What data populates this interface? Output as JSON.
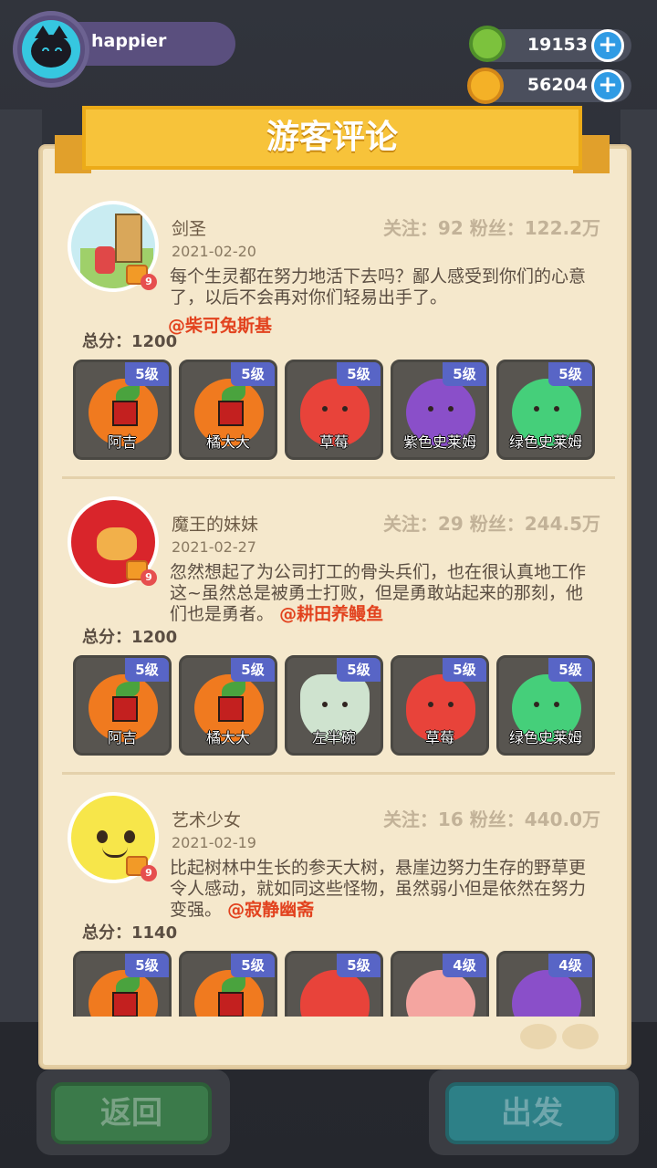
{
  "header": {
    "username": "happier",
    "currency_1": {
      "icon": "green-coin-icon",
      "value": "19153"
    },
    "currency_2": {
      "icon": "gold-planet-icon",
      "value": "56204"
    },
    "add_symbol": "+"
  },
  "title": "游客评论",
  "reviews": [
    {
      "name": "剑圣",
      "date": "2021-02-20",
      "stats": "关注：92 粉丝：122.2万",
      "level": "9",
      "text": "每个生灵都在努力地活下去吗？鄙人感受到你们的心意了，以后不会再对你们轻易出手了。",
      "mention": "@柴可兔斯基",
      "score": "总分：1200",
      "monsters": [
        {
          "name": "阿吉",
          "level": "5级",
          "kind": "orange"
        },
        {
          "name": "橘大大",
          "level": "5级",
          "kind": "orange"
        },
        {
          "name": "草莓",
          "level": "5级",
          "kind": "strawberry"
        },
        {
          "name": "紫色史莱姆",
          "level": "5级",
          "kind": "purple-slime"
        },
        {
          "name": "绿色史莱姆",
          "level": "5级",
          "kind": "green-slime"
        }
      ]
    },
    {
      "name": "魔王的妹妹",
      "date": "2021-02-27",
      "stats": "关注：29 粉丝：244.5万",
      "level": "9",
      "text": "忽然想起了为公司打工的骨头兵们，也在很认真地工作这~虽然总是被勇士打败，但是勇敢站起来的那刻，他们也是勇者。",
      "mention": "@耕田养鳗鱼",
      "score": "总分：1200",
      "monsters": [
        {
          "name": "阿吉",
          "level": "5级",
          "kind": "orange"
        },
        {
          "name": "橘大大",
          "level": "5级",
          "kind": "orange"
        },
        {
          "name": "左半碗",
          "level": "5级",
          "kind": "bowl"
        },
        {
          "name": "草莓",
          "level": "5级",
          "kind": "strawberry"
        },
        {
          "name": "绿色史莱姆",
          "level": "5级",
          "kind": "green-slime"
        }
      ]
    },
    {
      "name": "艺术少女",
      "date": "2021-02-19",
      "stats": "关注：16 粉丝：440.0万",
      "level": "9",
      "text": "比起树林中生长的参天大树，悬崖边努力生存的野草更令人感动，就如同这些怪物，虽然弱小但是依然在努力变强。",
      "mention": "@寂静幽斋",
      "score": "总分：1140",
      "monsters": [
        {
          "name": "",
          "level": "5级",
          "kind": "orange"
        },
        {
          "name": "",
          "level": "5级",
          "kind": "orange"
        },
        {
          "name": "",
          "level": "5级",
          "kind": "strawberry"
        },
        {
          "name": "",
          "level": "4级",
          "kind": "pink-slime"
        },
        {
          "name": "",
          "level": "4级",
          "kind": "purple-slime"
        }
      ]
    }
  ],
  "buttons": {
    "back": "返回",
    "go": "出发"
  },
  "colors": {
    "accent": "#f7c33a",
    "mention": "#e2421e",
    "level_badge": "#5865c6"
  }
}
